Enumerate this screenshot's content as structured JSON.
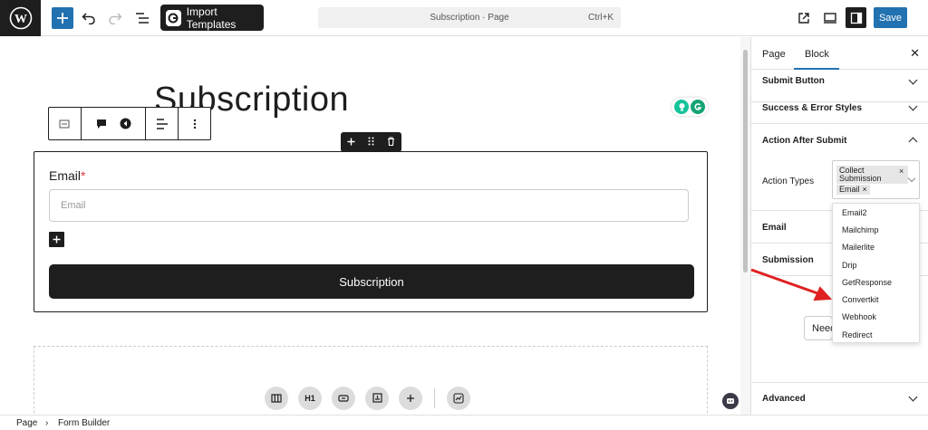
{
  "topbar": {
    "import_label": "Import Templates",
    "document_title": "Subscription · Page",
    "shortcut": "Ctrl+K",
    "save_label": "Save"
  },
  "canvas": {
    "page_title": "Subscription",
    "form": {
      "email_label": "Email",
      "required_mark": "*",
      "email_placeholder": "Email",
      "submit_label": "Subscription"
    },
    "inserter": {
      "heading_label": "H1"
    }
  },
  "sidebar": {
    "tabs": [
      "Page",
      "Block"
    ],
    "panels": {
      "submit_button": "Submit Button",
      "success_error": "Success & Error Styles",
      "action_after_submit": "Action After Submit",
      "email": "Email",
      "submission": "Submission",
      "advanced": "Advanced"
    },
    "action_types_label": "Action Types",
    "selected_chips": [
      "Collect Submission",
      "Email"
    ],
    "needs_button": "Need"
  },
  "dropdown": {
    "options": [
      "Email2",
      "Mailchimp",
      "Mailerlite",
      "Drip",
      "GetResponse",
      "Convertkit",
      "Webhook",
      "Redirect"
    ]
  },
  "footer": {
    "breadcrumbs": [
      "Page",
      "Form Builder"
    ]
  },
  "colors": {
    "accent": "#2271b1",
    "dark": "#1e1e1e",
    "arrow": "#e02020",
    "required": "#d63638"
  }
}
